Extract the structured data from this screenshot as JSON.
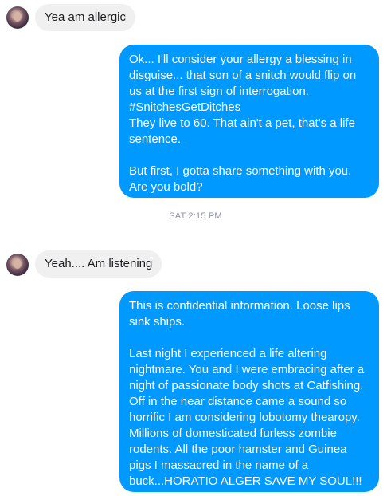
{
  "messages": [
    {
      "text": "Yea am allergic"
    },
    {
      "lines": [
        "Ok... I'll consider your allergy a blessing in",
        "disguise... that son of a snitch would flip on",
        "us at the first sign of interrogation.",
        "#SnitchesGetDitches",
        "They live to 60. That ain't a pet, that's a life",
        "sentence.",
        "",
        "But first, I gotta share something with you.",
        "Are you bold?"
      ]
    },
    {
      "text": "Yeah.... Am listening"
    },
    {
      "lines": [
        "This is confidential information. Loose lips",
        "sink ships.",
        "",
        "Last night I experienced a life altering",
        "nightmare. You and I were embracing after a",
        "night of passionate body shots at Catfishing.",
        "Off in the near distance came a sound so",
        "horrific I am considering lobotomy thearopy.",
        "Millions of domesticated furless zombie",
        "rodents. All the poor hamster and Guinea",
        "pigs I massacred in the name of a",
        "buck...HORATIO ALGER SAVE MY SOUL!!!"
      ]
    }
  ],
  "timestamp": "SAT 2:15 PM",
  "colors": {
    "outgoing": "#0099ff",
    "incoming": "#f1f0f0",
    "timestamp": "#8d949e"
  }
}
